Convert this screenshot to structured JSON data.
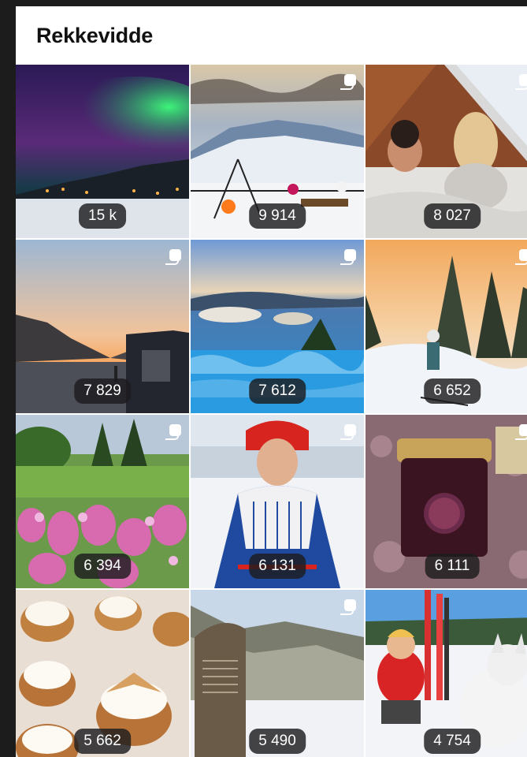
{
  "header": {
    "title": "Rekkevidde"
  },
  "posts": [
    {
      "reach": "15 k",
      "multi": false,
      "scene": "aurora"
    },
    {
      "reach": "9 914",
      "multi": true,
      "scene": "winter-terrace"
    },
    {
      "reach": "8 027",
      "multi": true,
      "scene": "cabin-couple"
    },
    {
      "reach": "7 829",
      "multi": true,
      "scene": "fjord-sunset"
    },
    {
      "reach": "7 612",
      "multi": true,
      "scene": "infinity-pool"
    },
    {
      "reach": "6 652",
      "multi": true,
      "scene": "skier-forest"
    },
    {
      "reach": "6 394",
      "multi": true,
      "scene": "flower-garden"
    },
    {
      "reach": "6 131",
      "multi": true,
      "scene": "sami-woman"
    },
    {
      "reach": "6 111",
      "multi": true,
      "scene": "plum-jelly"
    },
    {
      "reach": "5 662",
      "multi": false,
      "scene": "pastries"
    },
    {
      "reach": "5 490",
      "multi": true,
      "scene": "memorial-stone"
    },
    {
      "reach": "4 754",
      "multi": false,
      "scene": "child-dog-skis"
    }
  ]
}
